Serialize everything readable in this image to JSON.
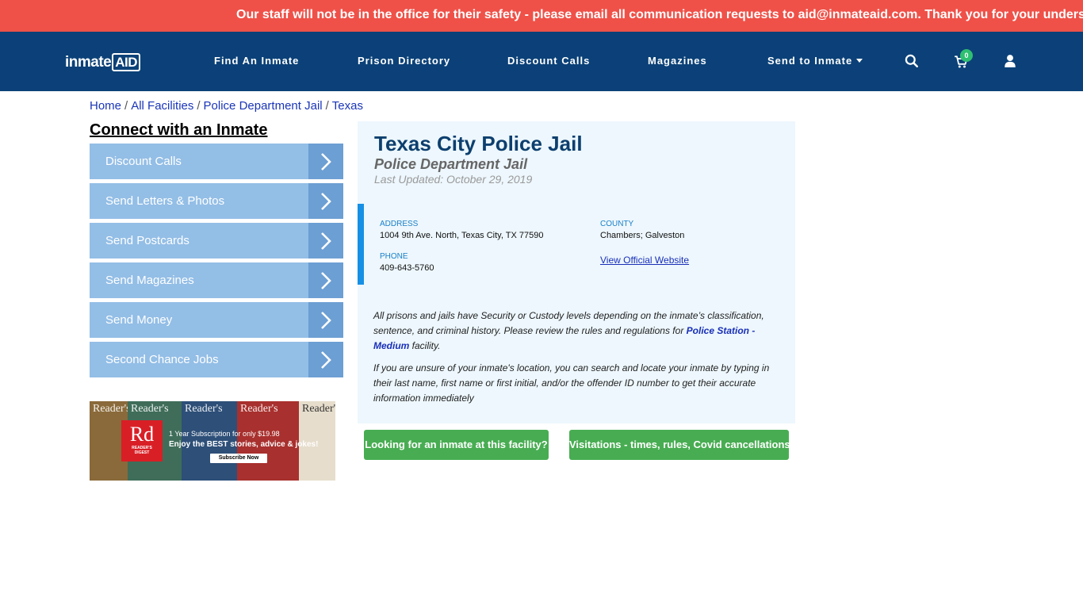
{
  "alert": {
    "text": "Our staff will not be in the office for their safety - please email all communication requests to aid@inmateaid.com. Thank you for your understanding."
  },
  "nav": {
    "logo_main": "inmate",
    "logo_aid": "AID",
    "items": [
      {
        "label": "Find An Inmate"
      },
      {
        "label": "Prison Directory"
      },
      {
        "label": "Discount Calls"
      },
      {
        "label": "Magazines"
      },
      {
        "label": "Send to Inmate"
      }
    ],
    "cart_count": "0",
    "icons": [
      "search-icon",
      "cart-icon",
      "user-icon",
      "chevron-down-icon"
    ]
  },
  "breadcrumb": {
    "items": [
      "Home",
      "All Facilities",
      "Police Department Jail",
      "Texas"
    ],
    "separator": "/"
  },
  "sidebar": {
    "title": "Connect with an Inmate",
    "items": [
      {
        "label": "Discount Calls"
      },
      {
        "label": "Send Letters & Photos"
      },
      {
        "label": "Send Postcards"
      },
      {
        "label": "Send Magazines"
      },
      {
        "label": "Send Money"
      },
      {
        "label": "Second Chance Jobs"
      }
    ]
  },
  "ad": {
    "cover_titles": [
      "Reader's",
      "Reader's",
      "Reader's",
      "Reader's",
      "Reader's",
      "Reader's"
    ],
    "logo": "Rd",
    "logo_sub1": "READER'S",
    "logo_sub2": "DIGEST",
    "promo_line1": "1 Year Subscription for only $19.98",
    "promo_line2": "Enjoy the BEST stories, advice & jokes!",
    "cta": "Subscribe Now"
  },
  "facility": {
    "name": "Texas City Police Jail",
    "type": "Police Department Jail",
    "last_updated": "Last Updated: October 29, 2019",
    "address_label": "ADDRESS",
    "address": "1004 9th Ave. North, Texas City, TX 77590",
    "county_label": "COUNTY",
    "county": "Chambers; Galveston",
    "phone_label": "PHONE",
    "phone": "409-643-5760",
    "website_link": "View Official Website",
    "para1_before": "All prisons and jails have Security or Custody levels depending on the inmate’s classification, sentence, and criminal history. Please review the rules and regulations for ",
    "para1_link": "Police Station - Medium",
    "para1_after": " facility.",
    "para2": "If you are unsure of your inmate's location, you can search and locate your inmate by typing in their last name, first name or first initial, and/or the offender ID number to get their accurate information immediately"
  },
  "actions": {
    "find_inmate": "Looking for an inmate at this facility?",
    "visitations": "Visitations - times, rules, Covid cancellations"
  },
  "colors": {
    "alert": "#ef5148",
    "nav": "#0b4178",
    "sidebar_button": "#93bee6",
    "sidebar_arrow": "#6c9fd3",
    "panel": "#edf7fd",
    "accent": "#1690e5",
    "action": "#48ad52",
    "title": "#0d3f6e"
  }
}
